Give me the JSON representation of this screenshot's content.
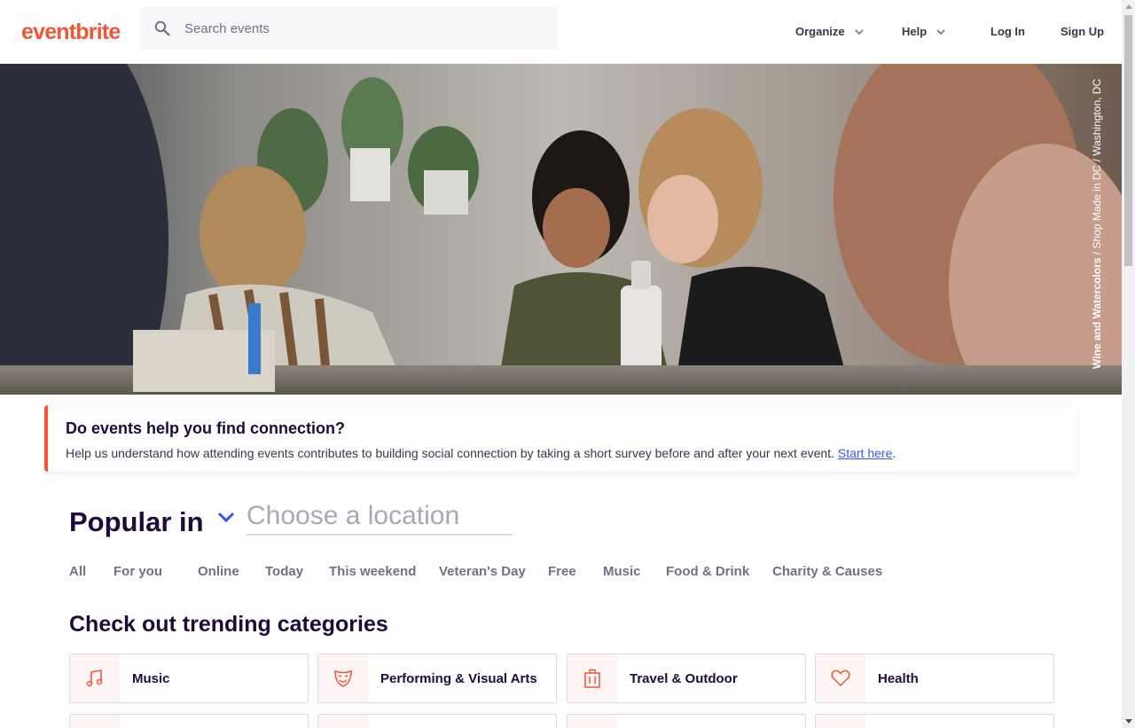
{
  "header": {
    "logo": "eventbrite",
    "search_placeholder": "Search events",
    "nav": [
      {
        "label": "Organize"
      },
      {
        "label": "Help"
      },
      {
        "label": "Log In"
      },
      {
        "label": "Sign Up"
      }
    ]
  },
  "hero": {
    "caption_bold": "Wine and Watercolors",
    "caption_rest": " / Shop Made in DC / Washington, DC"
  },
  "banner": {
    "title": "Do events help you find connection?",
    "text": "Help us understand how attending events contributes to building social connection by taking a short survey before and after your next event. ",
    "link": "Start here",
    "suffix": "."
  },
  "popular": {
    "label": "Popular in",
    "location_placeholder": "Choose a location"
  },
  "tabs": [
    "All",
    "For you",
    "Online",
    "Today",
    "This weekend",
    "Veteran's Day",
    "Free",
    "Music",
    "Food & Drink",
    "Charity & Causes"
  ],
  "categories": {
    "title": "Check out trending categories",
    "items": [
      {
        "label": "Music",
        "icon": "music-note-icon"
      },
      {
        "label": "Performing & Visual Arts",
        "icon": "theater-mask-icon"
      },
      {
        "label": "Travel & Outdoor",
        "icon": "luggage-icon"
      },
      {
        "label": "Health",
        "icon": "heart-icon"
      }
    ]
  },
  "colors": {
    "brand": "#f05537",
    "title": "#1e0a3c",
    "link": "#3659e3",
    "muted": "#6f7287"
  }
}
